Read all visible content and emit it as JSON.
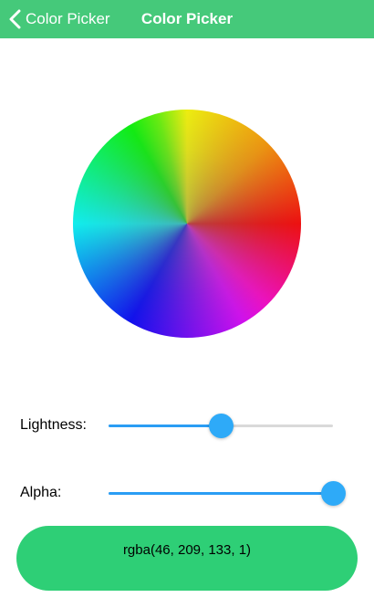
{
  "navbar": {
    "back_label": "Color Picker",
    "title": "Color Picker",
    "background_color": "#45c97a",
    "back_icon": "chevron-left-icon"
  },
  "color_wheel": {
    "type": "hue-wheel"
  },
  "lightness": {
    "label": "Lightness:",
    "value": 0.5
  },
  "alpha": {
    "label": "Alpha:",
    "value": 1.0
  },
  "result": {
    "text": "rgba(46, 209, 133, 1)",
    "color": "#2ecf76"
  },
  "accent_color": "#2eaaf8"
}
